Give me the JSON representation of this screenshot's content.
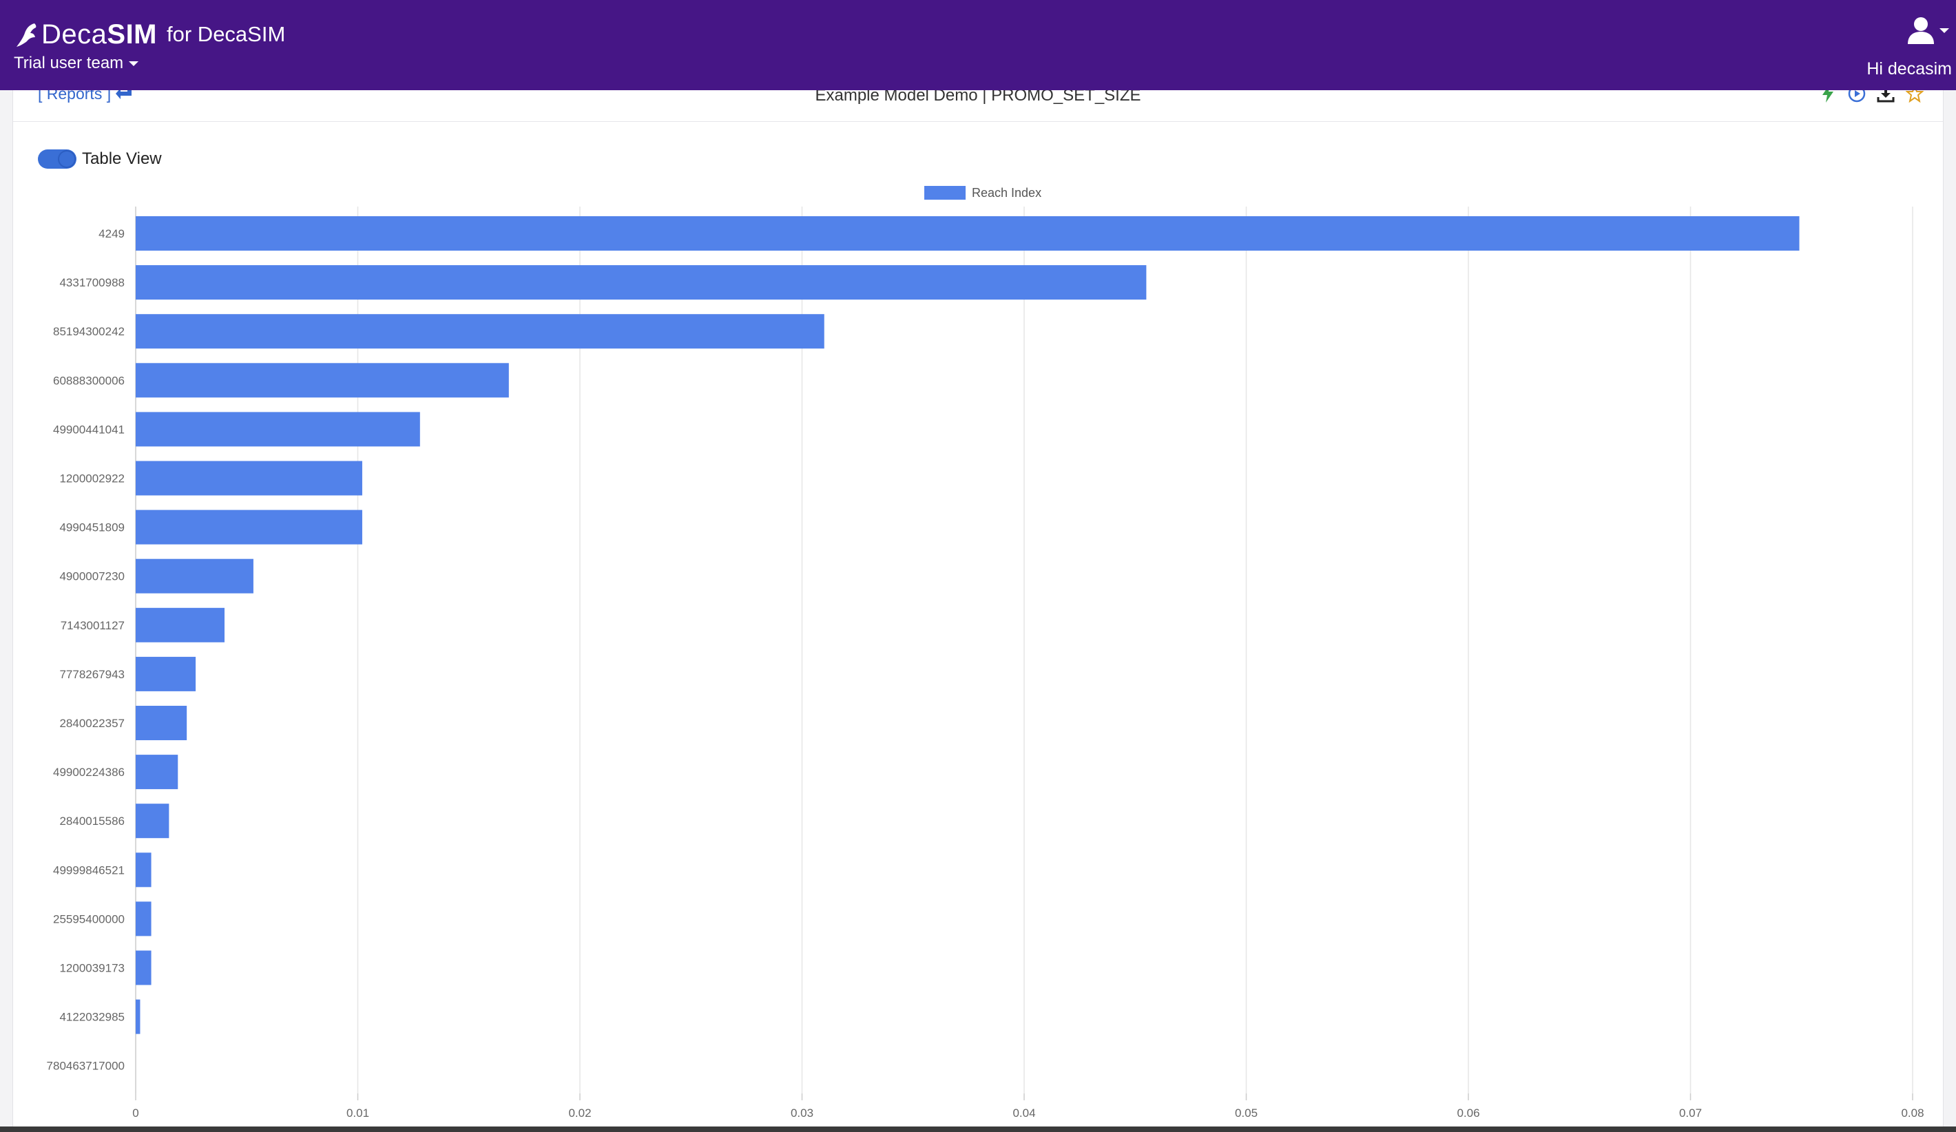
{
  "app": {
    "brand_name_light": "Deca",
    "brand_name_bold": "SIM",
    "brand_suffix": "for DecaSIM",
    "team": "Trial user team",
    "greeting": "Hi decasim"
  },
  "report": {
    "back_link": "[ Reports ]",
    "title": "Example Model Demo | PROMO_SET_SIZE",
    "toggle_label": "Table View",
    "toggle_on": true
  },
  "colors": {
    "navbar": "#461686",
    "bar": "#5282ea",
    "link": "#3366cc"
  },
  "icons": {
    "header_actions": [
      "lightning-icon",
      "play-icon",
      "download-icon",
      "star-icon"
    ],
    "user": "user-icon"
  },
  "chart_data": {
    "type": "bar",
    "orientation": "horizontal",
    "categories": [
      "4249",
      "4331700988",
      "85194300242",
      "60888300006",
      "49900441041",
      "1200002922",
      "4990451809",
      "4900007230",
      "7143001127",
      "7778267943",
      "2840022357",
      "49900224386",
      "2840015586",
      "49999846521",
      "25595400000",
      "1200039173",
      "4122032985",
      "780463717000"
    ],
    "series": [
      {
        "name": "Reach Index",
        "values": [
          0.0749,
          0.0455,
          0.031,
          0.0168,
          0.0128,
          0.0102,
          0.0102,
          0.0053,
          0.004,
          0.0027,
          0.0023,
          0.0019,
          0.0015,
          0.0007,
          0.0007,
          0.0007,
          0.0002,
          0.0
        ]
      }
    ],
    "xticks": [
      "0",
      "0.01",
      "0.02",
      "0.03",
      "0.04",
      "0.05",
      "0.06",
      "0.07",
      "0.08"
    ],
    "xlim": [
      0,
      0.08
    ],
    "grid": true,
    "legend": "top-center"
  }
}
